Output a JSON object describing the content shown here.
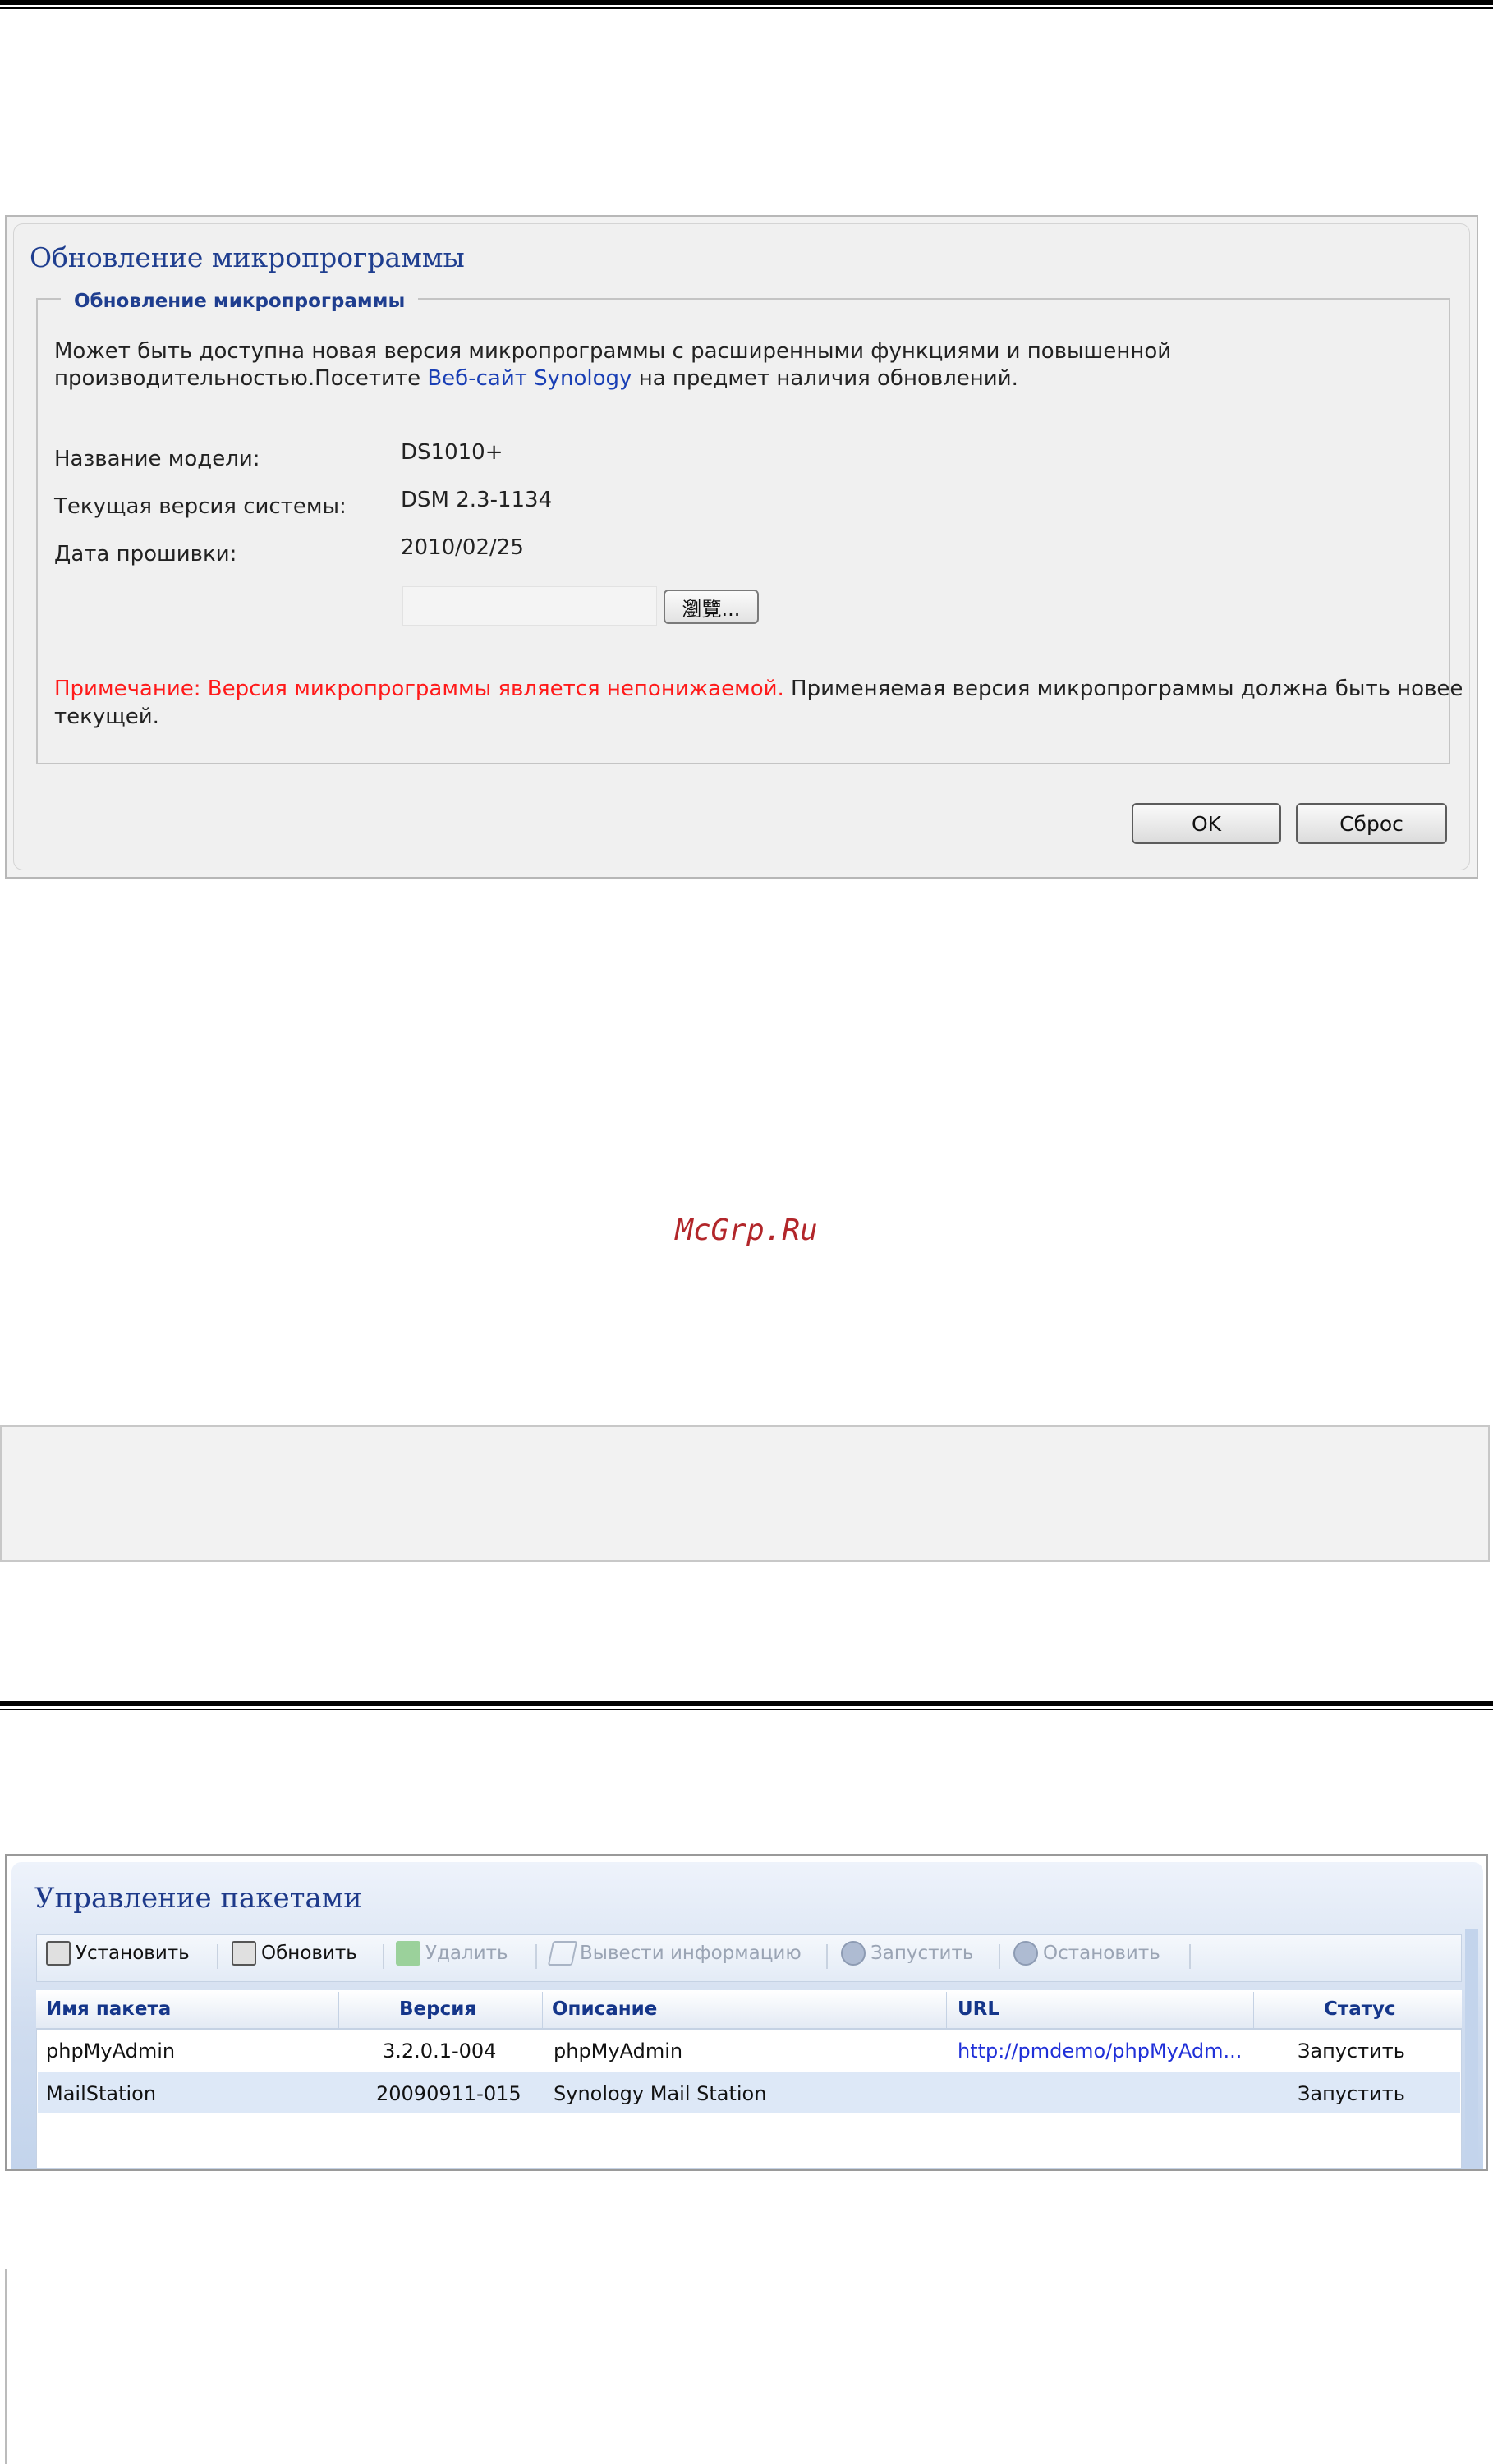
{
  "firmware": {
    "title": "Обновление микропрограммы",
    "section_legend": "Обновление микропрограммы",
    "intro_line1": "Может быть доступна новая версия микропрограммы с расширенными функциями и повышенной",
    "intro_line2_prefix": "производительностью.Посетите ",
    "intro_link": "Веб-сайт Synology",
    "intro_line2_suffix": " на предмет наличия обновлений.",
    "fields": {
      "model_label": "Название модели:",
      "model_value": "DS1010+",
      "version_label": "Текущая версия системы:",
      "version_value": "DSM 2.3-1134",
      "date_label": "Дата прошивки:",
      "date_value": "2010/02/25"
    },
    "browse_label": "瀏覽...",
    "note_red": "Примечание: Версия микропрограммы является непонижаемой.",
    "note_rest": " Применяемая версия микропрограммы должна быть новее",
    "note_line2": "текущей.",
    "ok_label": "OK",
    "reset_label": "Сброс"
  },
  "watermark": "McGrp.Ru",
  "packages": {
    "title": "Управление пакетами",
    "toolbar": [
      {
        "label": "Установить",
        "icon": "install-icon",
        "enabled": true
      },
      {
        "label": "Обновить",
        "icon": "update-icon",
        "enabled": true
      },
      {
        "label": "Удалить",
        "icon": "delete-icon",
        "enabled": false
      },
      {
        "label": "Вывести информацию",
        "icon": "info-icon",
        "enabled": false
      },
      {
        "label": "Запустить",
        "icon": "play-icon",
        "enabled": false
      },
      {
        "label": "Остановить",
        "icon": "pause-icon",
        "enabled": false
      }
    ],
    "columns": [
      "Имя пакета",
      "Версия",
      "Описание",
      "URL",
      "Статус"
    ],
    "rows": [
      {
        "name": "phpMyAdmin",
        "version": "3.2.0.1-004",
        "description": "phpMyAdmin",
        "url": "http://pmdemo/phpMyAdm...",
        "status": "Запустить"
      },
      {
        "name": "MailStation",
        "version": "20090911-015",
        "description": "Synology Mail Station",
        "url": "",
        "status": "Запустить"
      }
    ]
  },
  "colors": {
    "title_blue": "#1f3e8f",
    "note_red": "#ff1a1a",
    "link_blue": "#1a3fb5",
    "row_alt": "#dde8f7",
    "watermark": "#b2262a"
  }
}
